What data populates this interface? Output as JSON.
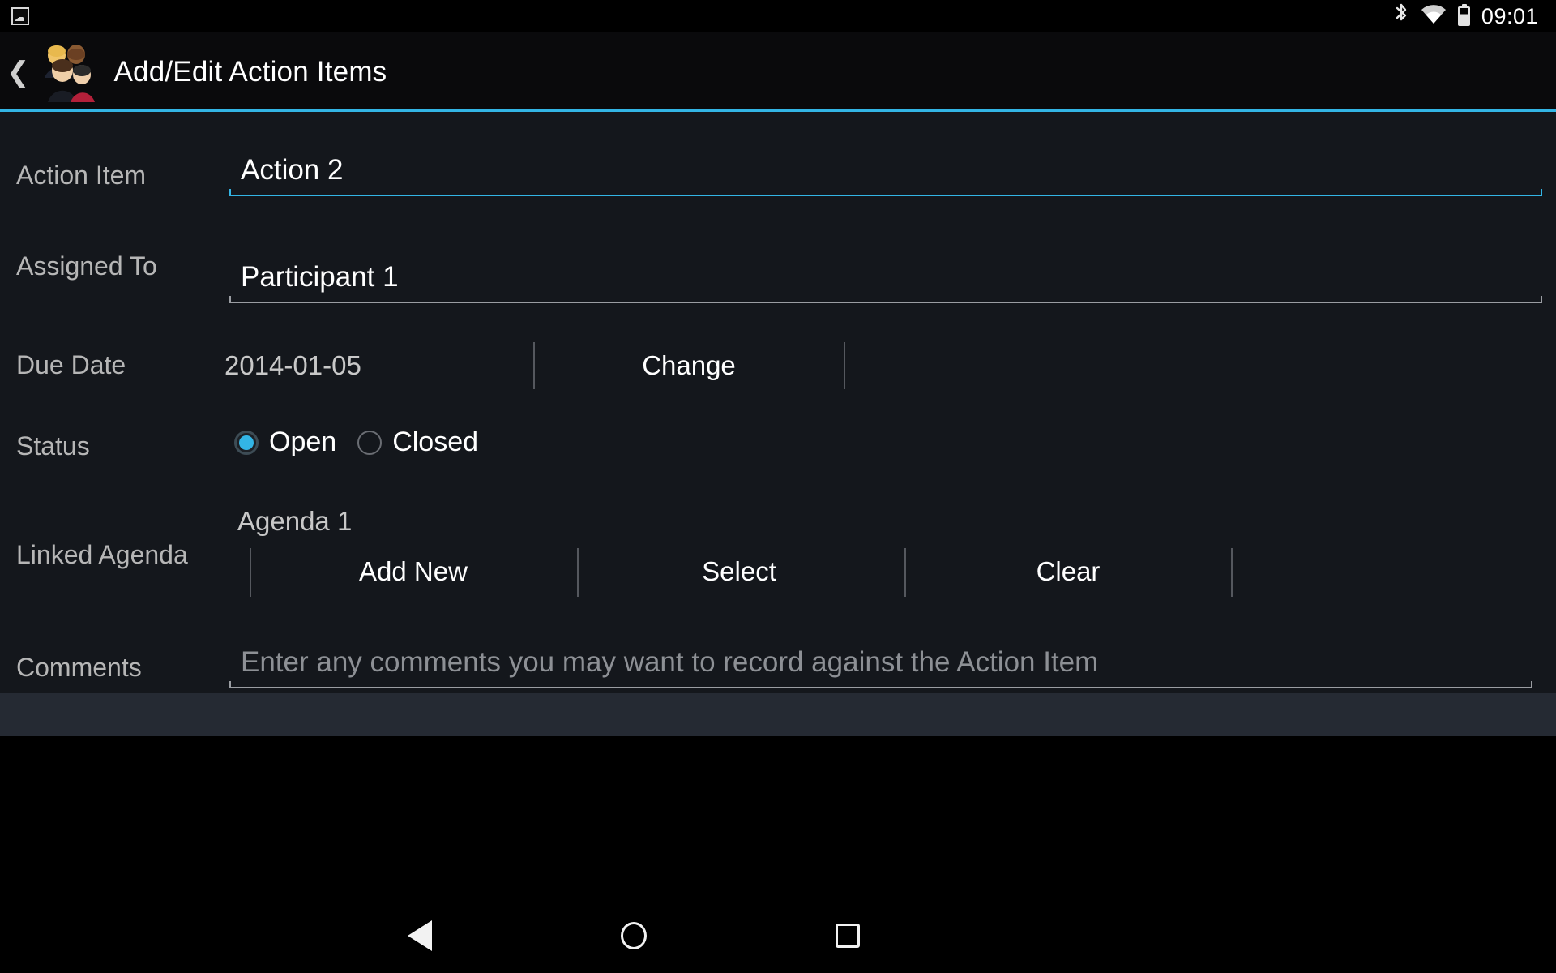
{
  "status_bar": {
    "notification_icon": "image-notification-icon",
    "bluetooth_icon": "bluetooth-icon",
    "wifi_icon": "wifi-icon",
    "battery_icon": "battery-icon",
    "time": "09:01"
  },
  "action_bar": {
    "back_icon": "back-chevron-icon",
    "app_icon": "people-group-icon",
    "title": "Add/Edit Action Items",
    "accent_color": "#33b5e5"
  },
  "form": {
    "action_item": {
      "label": "Action Item",
      "value": "Action 2",
      "placeholder": "Action Item",
      "focused": true
    },
    "assigned_to": {
      "label": "Assigned To",
      "value": "Participant 1",
      "placeholder": "Assigned To",
      "focused": false
    },
    "due_date": {
      "label": "Due Date",
      "value": "2014-01-05",
      "change_label": "Change"
    },
    "status": {
      "label": "Status",
      "options": [
        {
          "label": "Open",
          "selected": true
        },
        {
          "label": "Closed",
          "selected": false
        }
      ]
    },
    "linked_agenda": {
      "label": "Linked Agenda",
      "value": "Agenda 1",
      "add_new_label": "Add New",
      "select_label": "Select",
      "clear_label": "Clear"
    },
    "comments": {
      "label": "Comments",
      "value": "",
      "placeholder": "Enter any comments you may want to record against the Action Item"
    }
  },
  "nav_bar": {
    "back": "back-triangle-icon",
    "home": "home-circle-icon",
    "recents": "recents-square-icon"
  }
}
